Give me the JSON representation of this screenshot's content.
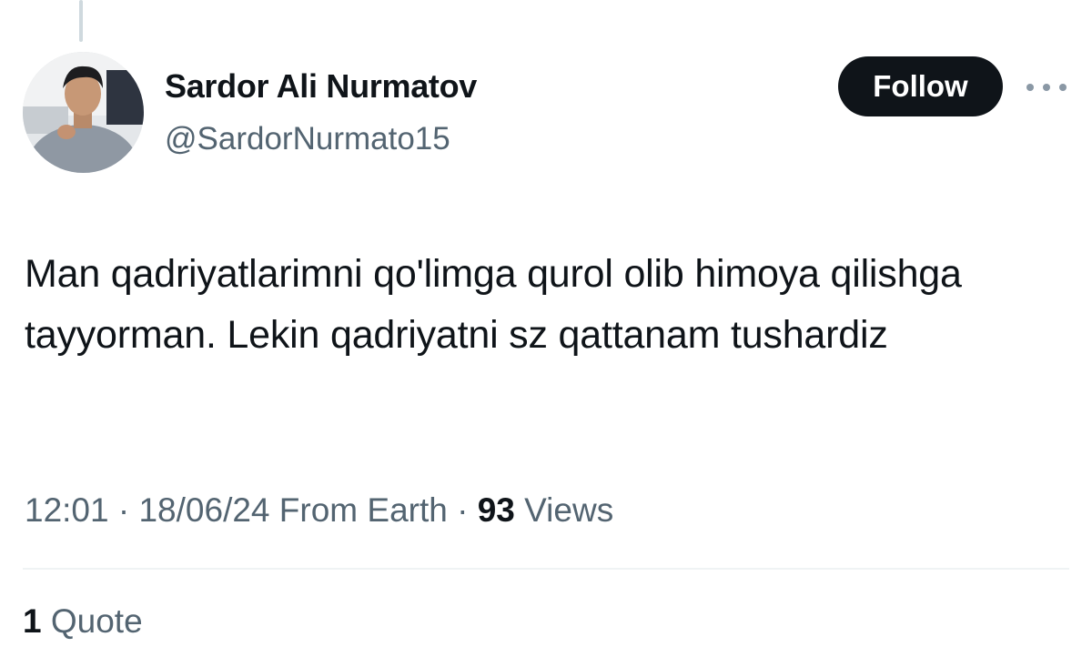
{
  "author": {
    "name": "Sardor Ali Nurmatov",
    "handle": "@SardorNurmato15"
  },
  "actions": {
    "follow_label": "Follow",
    "more_icon": "more-horizontal-icon"
  },
  "tweet": {
    "text": "Man qadriyatlarimni qo'limga qurol olib himoya qilishga tayyorman. Lekin qadriyatni sz qattanam tushardiz"
  },
  "meta": {
    "time": "12:01",
    "separator": "·",
    "date": "18/06/24",
    "source": "From Earth",
    "views_count": "93",
    "views_label": "Views"
  },
  "engagement": {
    "quote_count": "1",
    "quote_label": "Quote"
  },
  "colors": {
    "text_primary": "#0f1419",
    "text_secondary": "#536471",
    "follow_bg": "#0f1419",
    "follow_text": "#ffffff",
    "divider": "#eff3f4",
    "thread_line": "#cfd9de"
  }
}
